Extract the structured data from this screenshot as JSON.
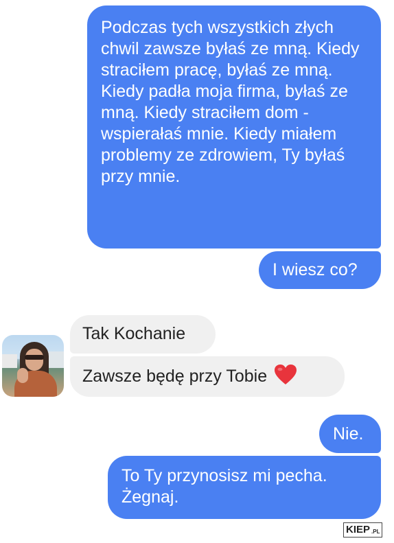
{
  "conversation": {
    "outgoing": [
      "Podczas tych wszystkich złych chwil zawsze byłaś ze mną. Kiedy straciłem pracę, byłaś ze mną. Kiedy padła moja firma, byłaś ze mną. Kiedy straciłem dom - wspierałaś mnie. Kiedy miałem problemy ze zdrowiem, Ty byłaś przy mnie.",
      "I wiesz co?",
      "Nie.",
      "To Ty przynosisz mi pecha. Żegnaj."
    ],
    "incoming": [
      "Tak Kochanie",
      "Zawsze będę przy Tobie"
    ]
  },
  "icons": {
    "heart": "heart-emoji-icon",
    "avatar": "contact-avatar"
  },
  "colors": {
    "outgoing_bubble": "#4a80f2",
    "incoming_bubble": "#f0f0f0",
    "heart": "#e8343c"
  },
  "watermark": {
    "main": "KIEP",
    "suffix": ".PL"
  }
}
